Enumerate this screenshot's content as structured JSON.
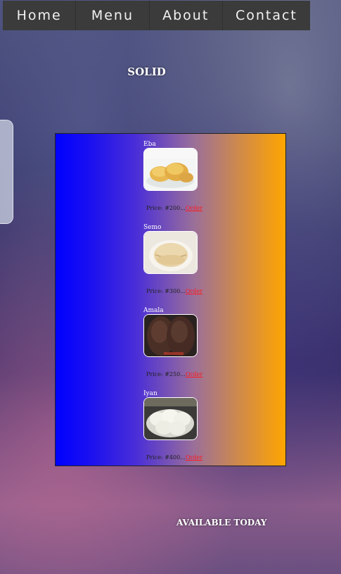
{
  "nav": {
    "items": [
      {
        "label": "Home"
      },
      {
        "label": "Menu"
      },
      {
        "label": "About"
      },
      {
        "label": "Contact"
      }
    ]
  },
  "heading": "SOLID",
  "foods": [
    {
      "name": "Eba",
      "price": "Price: #200...",
      "order": "Order"
    },
    {
      "name": "Semo",
      "price": "Price: #300...",
      "order": "Order"
    },
    {
      "name": "Amala",
      "price": "Price: #250...",
      "order": "Order"
    },
    {
      "name": "Iyan",
      "price": "Price: #400...",
      "order": "Order"
    }
  ],
  "footer": "AVAILABLE TODAY"
}
